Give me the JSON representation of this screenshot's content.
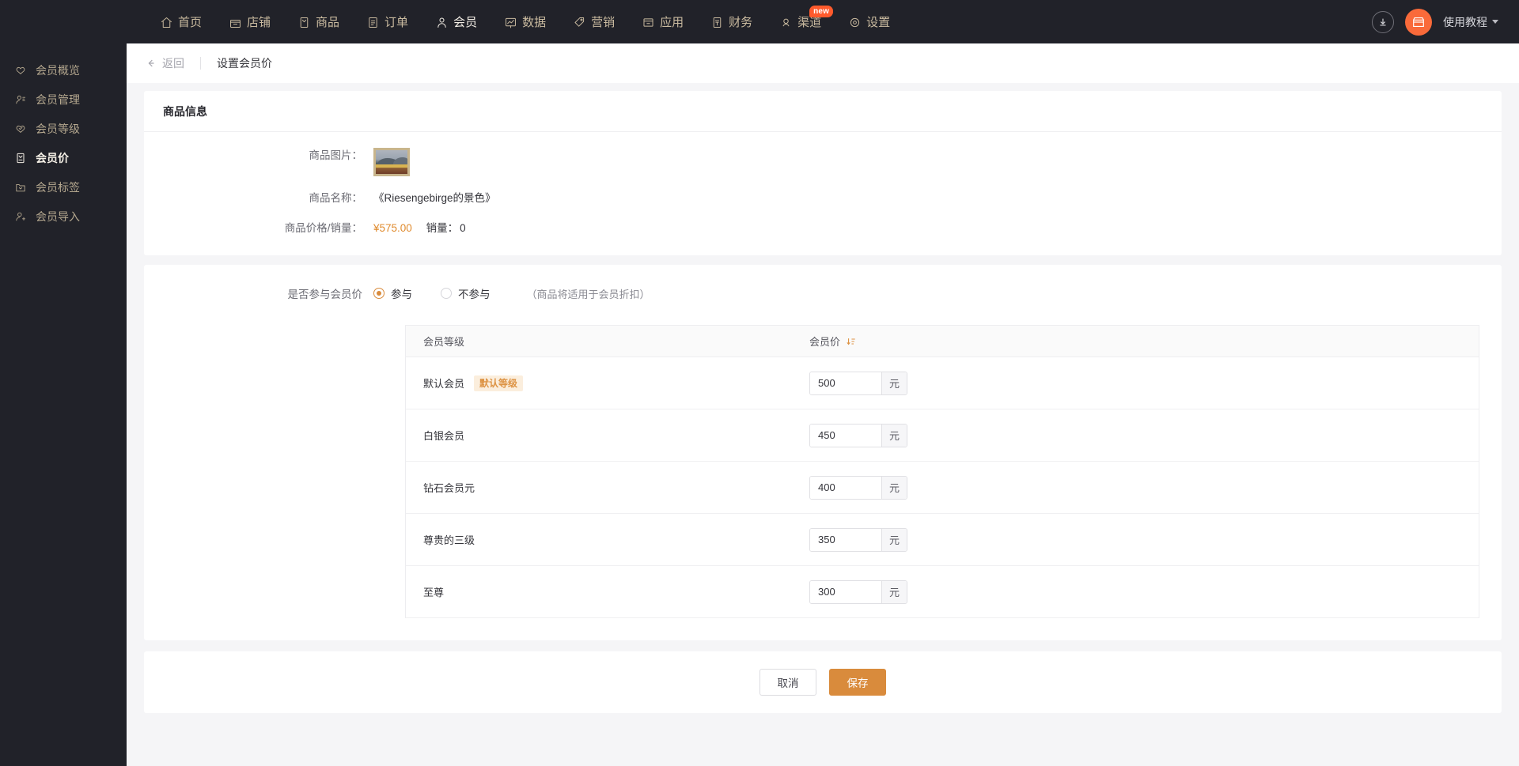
{
  "topnav": {
    "items": [
      {
        "label": "首页",
        "icon": "home-icon",
        "active": false
      },
      {
        "label": "店铺",
        "icon": "shop-icon",
        "active": false
      },
      {
        "label": "商品",
        "icon": "goods-icon",
        "active": false
      },
      {
        "label": "订单",
        "icon": "order-icon",
        "active": false
      },
      {
        "label": "会员",
        "icon": "member-icon",
        "active": true
      },
      {
        "label": "数据",
        "icon": "chart-icon",
        "active": false
      },
      {
        "label": "营销",
        "icon": "tag-icon",
        "active": false
      },
      {
        "label": "应用",
        "icon": "app-icon",
        "active": false
      },
      {
        "label": "财务",
        "icon": "finance-icon",
        "active": false
      },
      {
        "label": "渠道",
        "icon": "channel-icon",
        "active": false,
        "badge": "new"
      },
      {
        "label": "设置",
        "icon": "gear-icon",
        "active": false
      }
    ],
    "download_icon": "download-icon",
    "avatar_icon": "store-avatar-icon",
    "tutorial_label": "使用教程"
  },
  "sidebar": {
    "items": [
      {
        "label": "会员概览",
        "icon": "heart-outline-icon",
        "active": false
      },
      {
        "label": "会员管理",
        "icon": "user-settings-icon",
        "active": false
      },
      {
        "label": "会员等级",
        "icon": "heart-check-icon",
        "active": false
      },
      {
        "label": "会员价",
        "icon": "price-tag-icon",
        "active": true
      },
      {
        "label": "会员标签",
        "icon": "folder-tag-icon",
        "active": false
      },
      {
        "label": "会员导入",
        "icon": "user-add-icon",
        "active": false
      }
    ]
  },
  "pagehead": {
    "back_label": "返回",
    "back_icon": "arrow-left-icon",
    "title": "设置会员价"
  },
  "product_card": {
    "title": "商品信息",
    "rows": [
      {
        "label": "商品图片：",
        "type": "image",
        "alt": "landscape-painting-thumbnail"
      },
      {
        "label": "商品名称：",
        "type": "text",
        "value": "《Riesengebirge的景色》"
      }
    ],
    "price_row": {
      "label": "商品价格/销量：",
      "price": "¥575.00",
      "sales_label": "销量：",
      "sales_value": "0"
    }
  },
  "member_price": {
    "radio_label": "是否参与会员价",
    "options": [
      {
        "label": "参与",
        "selected": true
      },
      {
        "label": "不参与",
        "selected": false
      }
    ],
    "hint": "（商品将适用于会员折扣）",
    "table": {
      "columns": [
        "会员等级",
        "会员价"
      ],
      "sort_icon": "sort-descending-icon",
      "unit": "元",
      "rows": [
        {
          "level": "默认会员",
          "tag": "默认等级",
          "price": "500",
          "focused": false
        },
        {
          "level": "白银会员",
          "tag": "",
          "price": "450",
          "focused": false
        },
        {
          "level": "钻石会员元",
          "tag": "",
          "price": "400",
          "focused": false
        },
        {
          "level": "尊贵的三级",
          "tag": "",
          "price": "350",
          "focused": false
        },
        {
          "level": "至尊",
          "tag": "",
          "price": "300",
          "focused": true
        }
      ]
    }
  },
  "footer": {
    "cancel_label": "取消",
    "save_label": "保存"
  },
  "colors": {
    "nav_bg": "#212229",
    "nav_text": "#c9ba9f",
    "accent": "#d98b3c",
    "badge_new": "#ff5a2c",
    "price": "#e08b2e",
    "page_bg": "#f5f5f7"
  }
}
